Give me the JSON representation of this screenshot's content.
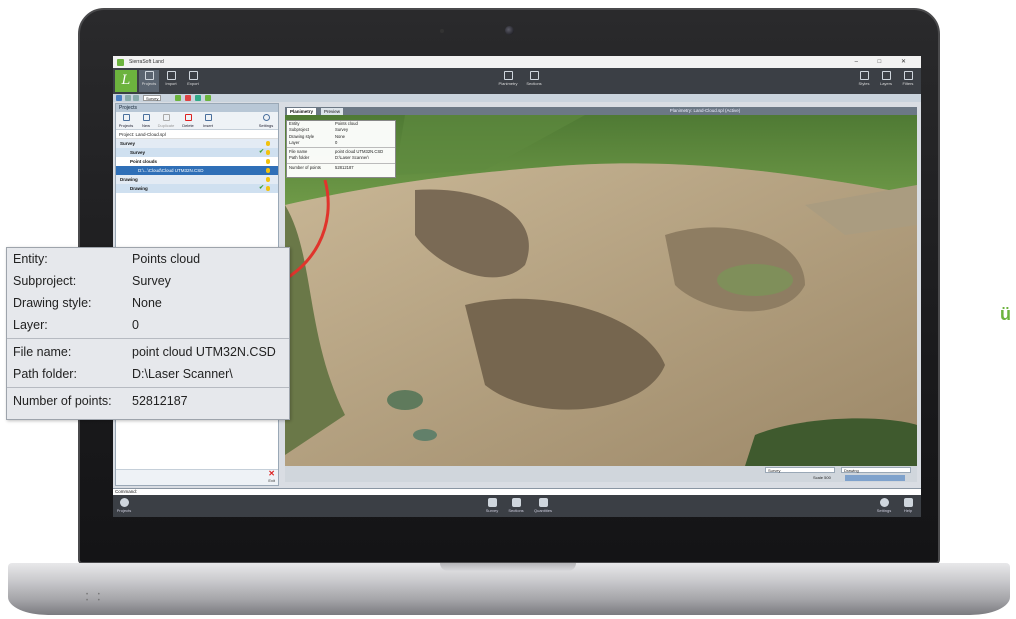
{
  "app": {
    "title": "SierraSoft Land",
    "window_controls": [
      "–",
      "□",
      "✕"
    ]
  },
  "ribbon": {
    "left": [
      {
        "label": "Projects",
        "icon": "folder-icon"
      },
      {
        "label": "Import",
        "icon": "import-icon"
      },
      {
        "label": "Export",
        "icon": "export-icon"
      }
    ],
    "center": [
      {
        "label": "Planimetry",
        "icon": "planimetry-icon"
      },
      {
        "label": "Sections",
        "icon": "sections-icon"
      }
    ],
    "right": [
      {
        "label": "Styles",
        "icon": "styles-icon"
      },
      {
        "label": "Layers",
        "icon": "layers-icon"
      },
      {
        "label": "Filters",
        "icon": "filter-icon"
      }
    ]
  },
  "quick_toolbar": {
    "subproject": "Survey"
  },
  "projects_panel": {
    "header": "Projects",
    "tools": [
      "Projects",
      "New",
      "Duplicate",
      "Delete",
      "Insert",
      "Settings"
    ],
    "project_label": "Project: Land-Cloud.spl",
    "tree": [
      {
        "label": "Survey",
        "kind": "section"
      },
      {
        "label": "Survey",
        "kind": "sub"
      },
      {
        "label": "Point clouds",
        "kind": "group"
      },
      {
        "label": "D:\\...\\Cloud\\Cloud UTM32N.CSD",
        "kind": "selected"
      },
      {
        "label": "Drawing",
        "kind": "section"
      },
      {
        "label": "Drawing",
        "kind": "sub"
      }
    ],
    "exit_label": "Exit"
  },
  "viewport": {
    "tabs": [
      "Planimetry",
      "Preview"
    ],
    "title": "Planimetry: Land-Cloud.spl (Active)",
    "status": {
      "subproject": "Survey",
      "drawing": "Drawing",
      "scale": "Scale 500"
    }
  },
  "mini_popup": {
    "rows": [
      {
        "k": "Entity",
        "v": "Points cloud"
      },
      {
        "k": "Subproject",
        "v": "Survey"
      },
      {
        "k": "Drawing style",
        "v": "None"
      },
      {
        "k": "Layer",
        "v": "0"
      },
      {
        "k": "File name",
        "v": "point cloud UTM32N.CSD"
      },
      {
        "k": "Path folder",
        "v": "D:\\Laser Scanner\\"
      },
      {
        "k": "Number of points",
        "v": "52812187"
      }
    ]
  },
  "command": {
    "label": "Command:"
  },
  "bottom_bar": {
    "left": [
      {
        "label": "Projects",
        "icon": "projects-icon"
      }
    ],
    "center": [
      {
        "label": "Survey",
        "icon": "survey-icon"
      },
      {
        "label": "Sections",
        "icon": "sections-icon"
      },
      {
        "label": "Quantities",
        "icon": "quantities-icon"
      }
    ],
    "right": [
      {
        "label": "Settings",
        "icon": "gear-icon"
      },
      {
        "label": "Help",
        "icon": "help-icon"
      }
    ]
  },
  "callout": {
    "group1": [
      {
        "key": "Entity:",
        "value": "Points cloud"
      },
      {
        "key": "Subproject:",
        "value": "Survey"
      },
      {
        "key": "Drawing style:",
        "value": "None"
      },
      {
        "key": "Layer:",
        "value": "0"
      }
    ],
    "group2": [
      {
        "key": "File name:",
        "value": "point cloud UTM32N.CSD"
      },
      {
        "key": "Path folder:",
        "value": "D:\\Laser Scanner\\"
      }
    ],
    "group3": [
      {
        "key": "Number of points:",
        "value": "52812187"
      }
    ]
  },
  "edge_fragment": "ü",
  "colors": {
    "brand_green": "#6cb33e",
    "arrow_red": "#e0342c",
    "ribbon_dark": "#3b3f45"
  }
}
